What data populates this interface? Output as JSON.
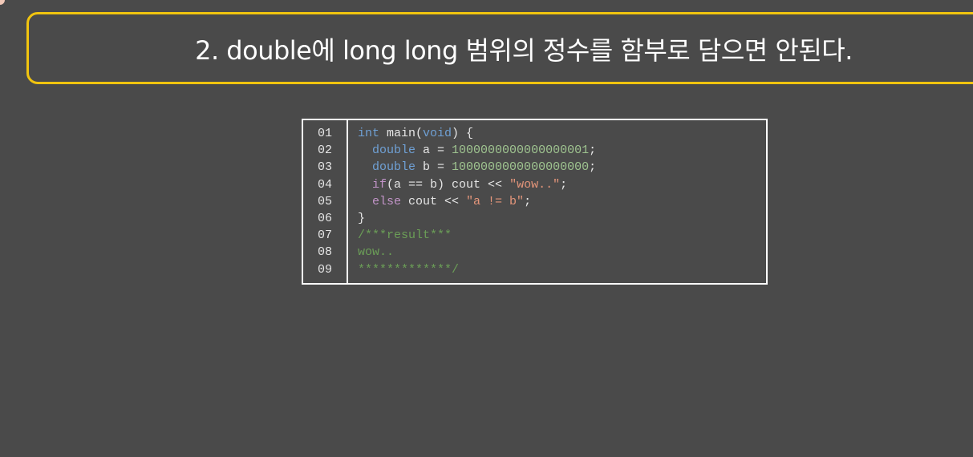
{
  "title": "2. double에 long long 범위의 정수를 함부로 담으면 안된다.",
  "line_numbers": [
    "01",
    "02",
    "03",
    "04",
    "05",
    "06",
    "07",
    "08",
    "09"
  ],
  "code": {
    "l1": {
      "kw": "int",
      "rest1": " main(",
      "kw2": "void",
      "rest2": ") {"
    },
    "l2": {
      "indent": "  ",
      "kw": "double",
      "rest": " a = ",
      "num": "1000000000000000001",
      "end": ";"
    },
    "l3": {
      "indent": "  ",
      "kw": "double",
      "rest": " b = ",
      "num": "1000000000000000000",
      "end": ";"
    },
    "l4": {
      "indent": "  ",
      "kw": "if",
      "rest": "(a == b) cout << ",
      "str": "\"wow..\"",
      "end": ";"
    },
    "l5": {
      "indent": "  ",
      "kw": "else",
      "rest": " cout << ",
      "str": "\"a != b\"",
      "end": ";"
    },
    "l6": "}",
    "l7": "/***result***",
    "l8": "wow..",
    "l9": "*************/"
  },
  "colors": {
    "keyword": "#6fa0d4",
    "control": "#c294c8",
    "number": "#9fc490",
    "string": "#e4957a",
    "comment": "#6b9e57",
    "banner_border": "#f1c40f"
  }
}
